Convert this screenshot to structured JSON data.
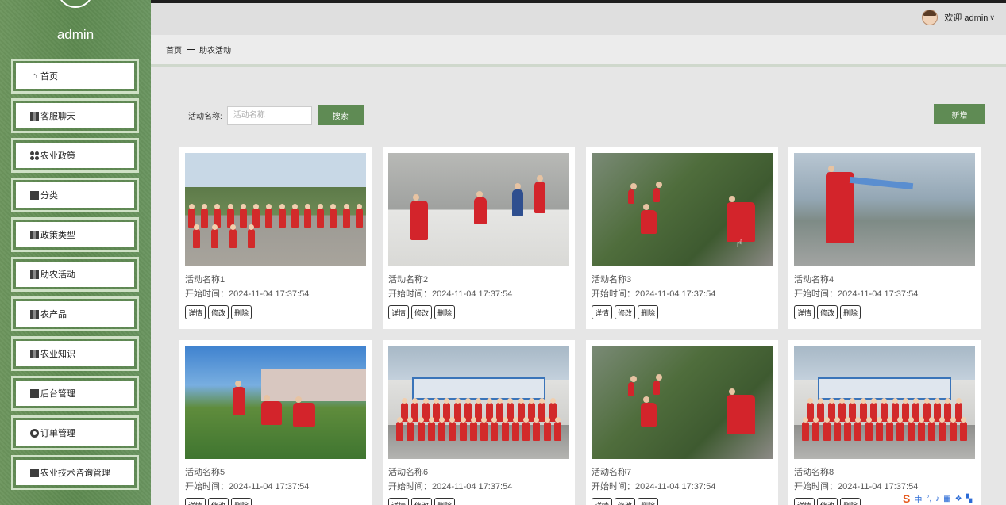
{
  "sidebar": {
    "username": "admin",
    "items": [
      {
        "label": "首页",
        "icon": "home-icon"
      },
      {
        "label": "客服聊天",
        "icon": "chat-icon"
      },
      {
        "label": "农业政策",
        "icon": "policy-icon"
      },
      {
        "label": "分类",
        "icon": "category-icon"
      },
      {
        "label": "政策类型",
        "icon": "policy-type-icon"
      },
      {
        "label": "助农活动",
        "icon": "activity-icon"
      },
      {
        "label": "农产品",
        "icon": "product-icon"
      },
      {
        "label": "农业知识",
        "icon": "knowledge-icon"
      },
      {
        "label": "后台管理",
        "icon": "admin-icon"
      },
      {
        "label": "订单管理",
        "icon": "order-icon"
      },
      {
        "label": "农业技术咨询管理",
        "icon": "consult-icon"
      }
    ]
  },
  "header": {
    "welcome": "欢迎 admin"
  },
  "breadcrumb": {
    "home": "首页",
    "separator": "—",
    "current": "助农活动"
  },
  "search": {
    "label": "活动名称:",
    "placeholder": "活动名称",
    "value": "",
    "button": "搜索",
    "add_button": "新增"
  },
  "card_actions": {
    "detail": "详情",
    "edit": "修改",
    "delete": "删除"
  },
  "cards": [
    {
      "name": "活动名称1",
      "time": "开始时间：2024-11-04 17:37:54"
    },
    {
      "name": "活动名称2",
      "time": "开始时间：2024-11-04 17:37:54"
    },
    {
      "name": "活动名称3",
      "time": "开始时间：2024-11-04 17:37:54"
    },
    {
      "name": "活动名称4",
      "time": "开始时间：2024-11-04 17:37:54"
    },
    {
      "name": "活动名称5",
      "time": "开始时间：2024-11-04 17:37:54"
    },
    {
      "name": "活动名称6",
      "time": "开始时间：2024-11-04 17:37:54"
    },
    {
      "name": "活动名称7",
      "time": "开始时间：2024-11-04 17:37:54"
    },
    {
      "name": "活动名称8",
      "time": "开始时间：2024-11-04 17:37:54"
    }
  ],
  "ime": {
    "mode": "中",
    "punct": "°,"
  },
  "colors": {
    "sidebar": "#5e8a51",
    "accent_green": "#5f8b54",
    "menu_border": "#cfe1c6"
  }
}
